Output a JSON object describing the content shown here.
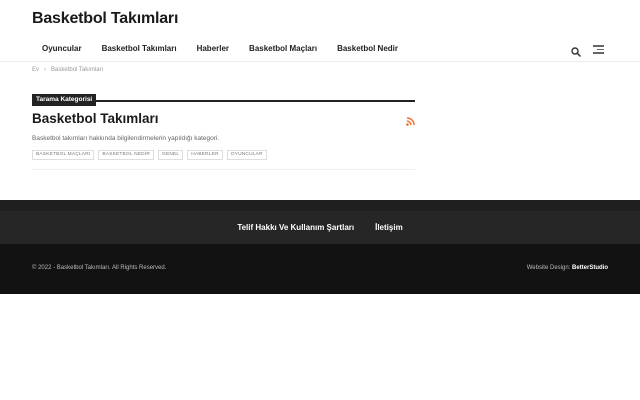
{
  "site": {
    "title": "Basketbol Takımları"
  },
  "nav": {
    "items": [
      {
        "label": "Oyuncular"
      },
      {
        "label": "Basketbol Takımları"
      },
      {
        "label": "Haberler"
      },
      {
        "label": "Basketbol Maçları"
      },
      {
        "label": "Basketbol Nedir"
      }
    ],
    "search_icon": "search-icon",
    "menu_icon": "hamburger-menu-icon"
  },
  "breadcrumb": {
    "home": "Ev",
    "separator": "›",
    "current": "Basketbol Takımları"
  },
  "category": {
    "badge": "Tarama Kategorisi",
    "title": "Basketbol Takımları",
    "description": "Basketbol takımları hakkında bilgilendirmelerin yapıldığı kategori.",
    "rss_icon": "rss-icon",
    "tags": [
      "BASKETBOL MAÇLARI",
      "BASKETBOL NEDİR",
      "GENEL",
      "HABERLER",
      "OYUNCULAR"
    ]
  },
  "footer": {
    "links": [
      "Telif Hakkı Ve Kullanım Şartları",
      "İletişim"
    ],
    "copyright": "© 2022 - Basketbol Takımları. All Rights Reserved.",
    "design_label": "Website Design: ",
    "design_by": "BetterStudio"
  },
  "colors": {
    "accent_underline": "#e37c84",
    "rss": "#f26522",
    "footer_dark": "#121212"
  }
}
